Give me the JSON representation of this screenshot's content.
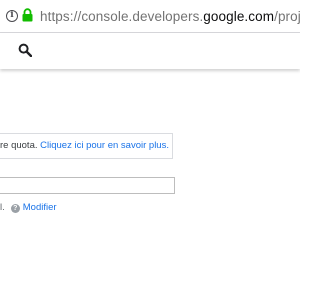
{
  "browser": {
    "url_prefix": "https://console.developers.",
    "url_domain": "google.com",
    "url_path": "/projectcreate?previ",
    "info_icon": "info-icon",
    "lock_icon": "lock-icon",
    "lock_color": "#12bc00"
  },
  "header": {
    "search_icon": "search-icon"
  },
  "notice": {
    "text": "re quota. ",
    "link": "Cliquez ici pour en savoir plus."
  },
  "project_name": {
    "value": ""
  },
  "project_id": {
    "suffix": "l.",
    "help_icon": "help-icon",
    "modify_label": "Modifier"
  },
  "colors": {
    "link": "#1a73e8",
    "text": "#3c4043"
  }
}
